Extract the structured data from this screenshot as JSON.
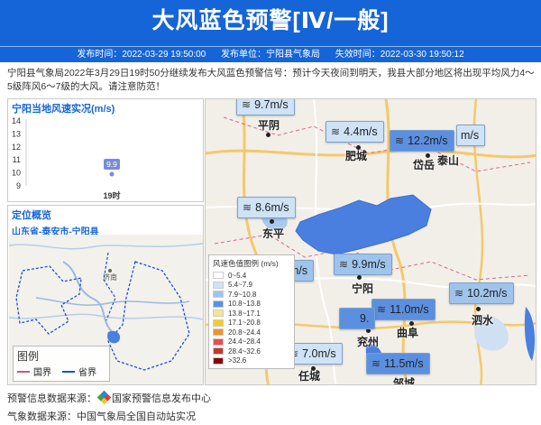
{
  "header": {
    "title": "大风蓝色预警[Ⅳ/一般]",
    "publish_time": "发布时间：2022-03-29 19:50:00",
    "publisher": "发布单位：宁阳县气象局",
    "expire_time": "失效时间：2022-03-30 19:50:12"
  },
  "notice": {
    "text": "宁阳县气象局2022年3月29日19时50分继续发布大风蓝色预警信号：预计今天夜间到明天，我县大部分地区将出现平均风力4～5级阵风6～7级的大风。请注意防范！"
  },
  "wind_chart": {
    "title": "宁阳当地风速实况(m/s)",
    "value_label": "9.9"
  },
  "chart_data": {
    "type": "scatter",
    "title": "宁阳当地风速实况(m/s)",
    "categories": [
      "19时"
    ],
    "values": [
      9.9
    ],
    "yticks": [
      "14",
      "13",
      "12",
      "11",
      "10",
      "9"
    ],
    "ylim": [
      9,
      14
    ]
  },
  "location": {
    "title": "定位概览",
    "subtitle": "山东省-泰安市-宁阳县",
    "minimap_city": "济南",
    "legend_title": "图例",
    "legend_items": [
      {
        "label": "国界",
        "color": "#c25b7a"
      },
      {
        "label": "省界",
        "color": "#1e4fd0"
      }
    ]
  },
  "map": {
    "wind_tags": [
      {
        "value": "9.7m/s",
        "style": "c1"
      },
      {
        "value": "4.4m/s",
        "style": "c1"
      },
      {
        "value": "12.2m/s",
        "style": "c3"
      },
      {
        "value": "m/s",
        "style": "c1"
      },
      {
        "value": "8.6m/s",
        "style": "c1"
      },
      {
        "value": "m/s",
        "style": "c2"
      },
      {
        "value": "9.9m/s",
        "style": "c2"
      },
      {
        "value": "10.2m/s",
        "style": "c2"
      },
      {
        "value": "11.0m/s",
        "style": "c3"
      },
      {
        "value": "9.",
        "style": "c3"
      },
      {
        "value": "7.0m/s",
        "style": "c1"
      },
      {
        "value": "11.5m/s",
        "style": "c3"
      }
    ],
    "towns": [
      "平阴",
      "肥城",
      "岱岳",
      "泰山",
      "东平",
      "宁阳",
      "泗水",
      "曲阜",
      "兖州",
      "任城",
      "邹城"
    ],
    "legend_title": "风速色值图例 (m/s)",
    "scale": [
      {
        "label": "0~5.4",
        "color": "#ffffff"
      },
      {
        "label": "5.4~7.9",
        "color": "#cfe3f7"
      },
      {
        "label": "7.9~10.8",
        "color": "#9ec4ec"
      },
      {
        "label": "10.8~13.8",
        "color": "#5b8fe0"
      },
      {
        "label": "13.8~17.1",
        "color": "#f6e58d"
      },
      {
        "label": "17.1~20.8",
        "color": "#f9ca24"
      },
      {
        "label": "20.8~24.4",
        "color": "#f0932b"
      },
      {
        "label": "24.4~28.4",
        "color": "#eb4d4b"
      },
      {
        "label": "28.4~32.6",
        "color": "#c0392b"
      },
      {
        "label": ">32.6",
        "color": "#8b0000"
      }
    ]
  },
  "footer": {
    "warning_source": "预警信息数据来源：",
    "warning_source_name": "国家预警信息发布中心",
    "weather_source": "气象数据来源：中国气象局全国自动站实况"
  },
  "colors": {
    "primary": "#1565d8",
    "warning_area": "#4a7fe0"
  }
}
